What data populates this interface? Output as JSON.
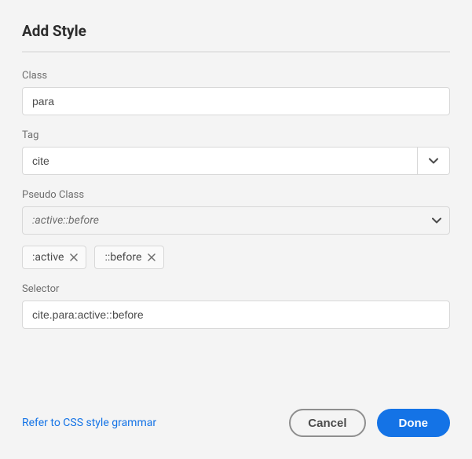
{
  "title": "Add Style",
  "fields": {
    "class": {
      "label": "Class",
      "value": "para"
    },
    "tag": {
      "label": "Tag",
      "value": "cite"
    },
    "pseudoClass": {
      "label": "Pseudo Class",
      "placeholder": ":active::before"
    },
    "selector": {
      "label": "Selector",
      "value": "cite.para:active::before"
    }
  },
  "chips": [
    {
      "label": ":active"
    },
    {
      "label": "::before"
    }
  ],
  "footer": {
    "link": "Refer to CSS style grammar",
    "cancel": "Cancel",
    "done": "Done"
  }
}
